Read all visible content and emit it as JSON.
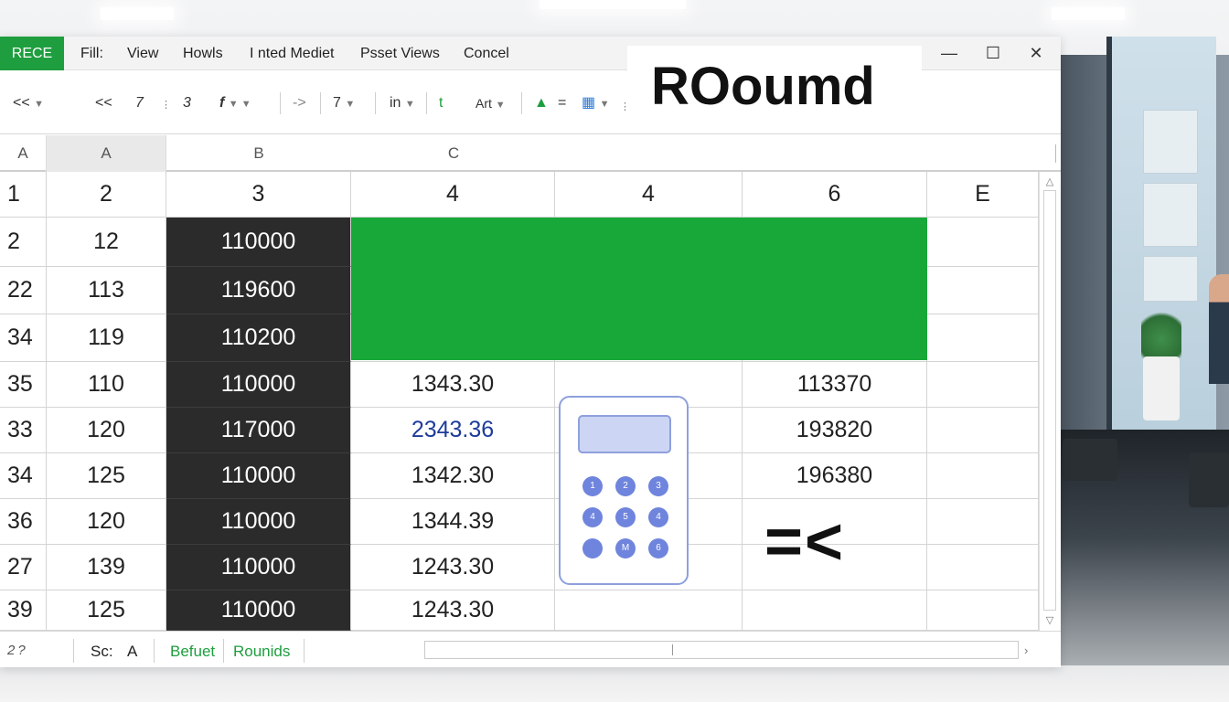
{
  "menubar": {
    "app_badge": "RECE",
    "items": [
      "Fill:",
      "View",
      "Howls",
      "I nted Mediet",
      "Psset Views",
      "Concel"
    ]
  },
  "toolbar": {
    "items": [
      "<<",
      "<<",
      "7",
      "3",
      "f",
      "->",
      "7",
      "in",
      "t",
      "Art",
      "="
    ],
    "title": "ROoumd"
  },
  "column_headers": [
    "A",
    "A",
    "B",
    "C"
  ],
  "grid": {
    "header_row": [
      "1",
      "2",
      "3",
      "4",
      "4",
      "6",
      "E"
    ],
    "rows": [
      {
        "head": "2",
        "a": "12",
        "b": "110000",
        "c": "",
        "d": "",
        "e": ""
      },
      {
        "head": "22",
        "a": "113",
        "b": "119600",
        "c": "",
        "d": "",
        "e": ""
      },
      {
        "head": "34",
        "a": "119",
        "b": "110200",
        "c": "",
        "d": "",
        "e": ""
      },
      {
        "head": "35",
        "a": "110",
        "b": "110000",
        "c": "1343.30",
        "d": "",
        "e": "113370"
      },
      {
        "head": "33",
        "a": "120",
        "b": "117000",
        "c": "2343.36",
        "d": "",
        "e": "193820"
      },
      {
        "head": "34",
        "a": "125",
        "b": "110000",
        "c": "1342.30",
        "d": "",
        "e": "196380"
      },
      {
        "head": "36",
        "a": "120",
        "b": "110000",
        "c": "1344.39",
        "d": "",
        "e": ""
      },
      {
        "head": "27",
        "a": "139",
        "b": "110000",
        "c": "1243.30",
        "d": "",
        "e": ""
      },
      {
        "head": "39",
        "a": "125",
        "b": "110000",
        "c": "1243.30",
        "d": "",
        "e": ""
      }
    ],
    "highlight_color": "#18a83a",
    "dark_column_color": "#2b2b2b"
  },
  "calculator": {
    "keys": [
      "1",
      "2",
      "3",
      "4",
      "5",
      "4",
      "",
      "M",
      "6"
    ]
  },
  "overlay_symbol": "=<",
  "tabbar": {
    "left_label": "2 ?",
    "tabs": [
      "Sc:",
      "A",
      "Befuet",
      "Rounids"
    ]
  }
}
